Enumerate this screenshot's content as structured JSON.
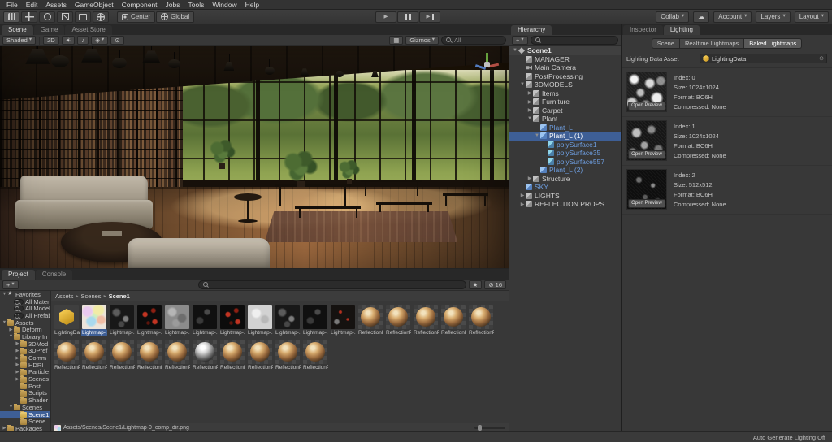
{
  "colors": {
    "selection_blue": "#3e5f96",
    "prefab_blue": "#6e9ee0",
    "folder_yellow": "#c9a55a",
    "window_bg": "#383838",
    "strip_bg": "#282828"
  },
  "icons": {
    "dropdown": "▾",
    "play": "▶",
    "cloud": "☁",
    "audio": "♪",
    "light": "☀",
    "effects": "◈",
    "eye": "⊙",
    "grid": "▦",
    "picker": "⊙",
    "star": "★",
    "crumb_sep": "▸",
    "hidden": "⊘"
  },
  "menu_bar": {
    "items": [
      "File",
      "Edit",
      "Assets",
      "GameObject",
      "Component",
      "Jobs",
      "Tools",
      "Window",
      "Help"
    ]
  },
  "toolbar": {
    "pivot": "Center",
    "space": "Global",
    "collab": "Collab",
    "account": "Account",
    "layers": "Layers",
    "layout": "Layout"
  },
  "scene_panel": {
    "tabs": [
      {
        "label": "Scene",
        "active": true
      },
      {
        "label": "Game"
      },
      {
        "label": "Asset Store"
      }
    ],
    "toolbar": {
      "draw_mode": "Shaded",
      "toggle_2d": "2D",
      "gizmos": "Gizmos",
      "search_placeholder": "All"
    }
  },
  "hierarchy_panel": {
    "tab": "Hierarchy",
    "create": "+",
    "rows": [
      {
        "label": "Scene1",
        "depth": 0,
        "arrow": "▼",
        "icon": "scene",
        "header": true
      },
      {
        "label": "MANAGER",
        "depth": 1,
        "icon": "go"
      },
      {
        "label": "Main Camera",
        "depth": 1,
        "icon": "camera"
      },
      {
        "label": "PostProcessing",
        "depth": 1,
        "icon": "go"
      },
      {
        "label": "3DMODELS",
        "depth": 1,
        "arrow": "▼",
        "icon": "go"
      },
      {
        "label": "Items",
        "depth": 2,
        "arrow": "▶",
        "icon": "go"
      },
      {
        "label": "Furniture",
        "depth": 2,
        "arrow": "▶",
        "icon": "go"
      },
      {
        "label": "Carpet",
        "depth": 2,
        "arrow": "▶",
        "icon": "go"
      },
      {
        "label": "Plant",
        "depth": 2,
        "arrow": "▼",
        "icon": "go"
      },
      {
        "label": "Plant_L",
        "depth": 3,
        "icon": "prefab",
        "blue": true
      },
      {
        "label": "Plant_L (1)",
        "depth": 3,
        "arrow": "▼",
        "icon": "prefab",
        "blue": true,
        "selected": true
      },
      {
        "label": "polySurface1",
        "depth": 4,
        "icon": "mesh",
        "blue": true
      },
      {
        "label": "polySurface35",
        "depth": 4,
        "icon": "mesh",
        "blue": true
      },
      {
        "label": "polySurface557",
        "depth": 4,
        "icon": "mesh",
        "blue": true
      },
      {
        "label": "Plant_L (2)",
        "depth": 3,
        "icon": "prefab",
        "blue": true
      },
      {
        "label": "Structure",
        "depth": 2,
        "arrow": "▶",
        "icon": "go"
      },
      {
        "label": "SKY",
        "depth": 1,
        "icon": "prefab",
        "blue": true
      },
      {
        "label": "LIGHTS",
        "depth": 1,
        "arrow": "▶",
        "icon": "go"
      },
      {
        "label": "REFLECTION PROPS",
        "depth": 1,
        "arrow": "▶",
        "icon": "go"
      }
    ]
  },
  "project_panel": {
    "tabs": [
      {
        "label": "Project",
        "active": true
      },
      {
        "label": "Console"
      }
    ],
    "create": "+",
    "hidden_count": "16",
    "breadcrumb": [
      "Assets",
      "Scenes",
      "Scene1"
    ],
    "tree": [
      {
        "label": "Favorites",
        "depth": 0,
        "arrow": "▼",
        "icon": "star"
      },
      {
        "label": "All Materi",
        "depth": 1,
        "icon": "search"
      },
      {
        "label": "All Model",
        "depth": 1,
        "icon": "search"
      },
      {
        "label": "All Prefab",
        "depth": 1,
        "icon": "search"
      },
      {
        "label": "Assets",
        "depth": 0,
        "arrow": "▼",
        "icon": "folder"
      },
      {
        "label": "Deform",
        "depth": 1,
        "arrow": "▶",
        "icon": "folder"
      },
      {
        "label": "Library In",
        "depth": 1,
        "arrow": "▼",
        "icon": "folder"
      },
      {
        "label": "3DMod",
        "depth": 2,
        "arrow": "▶",
        "icon": "folder"
      },
      {
        "label": "3DPref",
        "depth": 2,
        "arrow": "▶",
        "icon": "folder"
      },
      {
        "label": "Comm",
        "depth": 2,
        "arrow": "▶",
        "icon": "folder"
      },
      {
        "label": "HDRI",
        "depth": 2,
        "arrow": "▶",
        "icon": "folder"
      },
      {
        "label": "Particle",
        "depth": 2,
        "arrow": "▶",
        "icon": "folder"
      },
      {
        "label": "Scenes",
        "depth": 2,
        "arrow": "▶",
        "icon": "folder"
      },
      {
        "label": "Post",
        "depth": 2,
        "icon": "folder"
      },
      {
        "label": "Scripts",
        "depth": 2,
        "icon": "folder"
      },
      {
        "label": "Shader",
        "depth": 2,
        "icon": "folder"
      },
      {
        "label": "Scenes",
        "depth": 1,
        "arrow": "▼",
        "icon": "folder"
      },
      {
        "label": "Scene1",
        "depth": 2,
        "icon": "folder-open",
        "selected": true
      },
      {
        "label": "Scene",
        "depth": 2,
        "icon": "folder"
      },
      {
        "label": "Packages",
        "depth": 0,
        "arrow": "▶",
        "icon": "folder"
      }
    ],
    "grid": [
      {
        "label": "LightingDa...",
        "thumb": "lighting-data"
      },
      {
        "label": "Lightmap-...",
        "thumb": "lm-color",
        "selected": true
      },
      {
        "label": "Lightmap-...",
        "thumb": "lm-dark"
      },
      {
        "label": "Lightmap-...",
        "thumb": "lm-red"
      },
      {
        "label": "Lightmap-...",
        "thumb": "lm-gray"
      },
      {
        "label": "Lightmap-...",
        "thumb": "lm-dark2"
      },
      {
        "label": "Lightmap-...",
        "thumb": "lm-red"
      },
      {
        "label": "Lightmap-...",
        "thumb": "lm-light"
      },
      {
        "label": "Lightmap-...",
        "thumb": "lm-dark"
      },
      {
        "label": "Lightmap-...",
        "thumb": "lm-dark2"
      },
      {
        "label": "Lightmap-...",
        "thumb": "lm-red2"
      },
      {
        "label": "ReflectionP...",
        "thumb": "probe"
      },
      {
        "label": "ReflectionP...",
        "thumb": "probe"
      },
      {
        "label": "ReflectionP...",
        "thumb": "probe"
      },
      {
        "label": "ReflectionP...",
        "thumb": "probe"
      },
      {
        "label": "ReflectionP...",
        "thumb": "probe"
      },
      {
        "label": "ReflectionP...",
        "thumb": "probe"
      },
      {
        "label": "ReflectionP...",
        "thumb": "probe"
      },
      {
        "label": "ReflectionP...",
        "thumb": "probe"
      },
      {
        "label": "ReflectionP...",
        "thumb": "probe"
      },
      {
        "label": "ReflectionP...",
        "thumb": "probe"
      },
      {
        "label": "ReflectionP...",
        "thumb": "probe-bw"
      },
      {
        "label": "ReflectionP...",
        "thumb": "probe"
      },
      {
        "label": "ReflectionP...",
        "thumb": "probe"
      },
      {
        "label": "ReflectionP...",
        "thumb": "probe"
      },
      {
        "label": "ReflectionP...",
        "thumb": "probe"
      }
    ],
    "footer_path": "Assets/Scenes/Scene1/Lightmap-0_comp_dir.png"
  },
  "inspector_panel": {
    "tabs": [
      {
        "label": "Inspector"
      },
      {
        "label": "Lighting",
        "active": true
      }
    ],
    "sub_tabs": [
      {
        "label": "Scene"
      },
      {
        "label": "Realtime Lightmaps"
      },
      {
        "label": "Baked Lightmaps",
        "active": true
      }
    ],
    "lighting_data_asset_label": "Lighting Data Asset",
    "lighting_data_asset_value": "LightingData",
    "open_preview": "Open Preview",
    "lightmaps": [
      {
        "index_line": "Index: 0",
        "size_line": "Size: 1024x1024",
        "format_line": "Format: BC6H",
        "compressed_line": "Compressed: None",
        "thumb": "noise-bright"
      },
      {
        "index_line": "Index: 1",
        "size_line": "Size: 1024x1024",
        "format_line": "Format: BC6H",
        "compressed_line": "Compressed: None",
        "thumb": "noise-mid"
      },
      {
        "index_line": "Index: 2",
        "size_line": "Size: 512x512",
        "format_line": "Format: BC6H",
        "compressed_line": "Compressed: None",
        "thumb": "noise-dark"
      }
    ]
  },
  "status_bar": {
    "auto_generate": "Auto Generate Lighting Off"
  }
}
